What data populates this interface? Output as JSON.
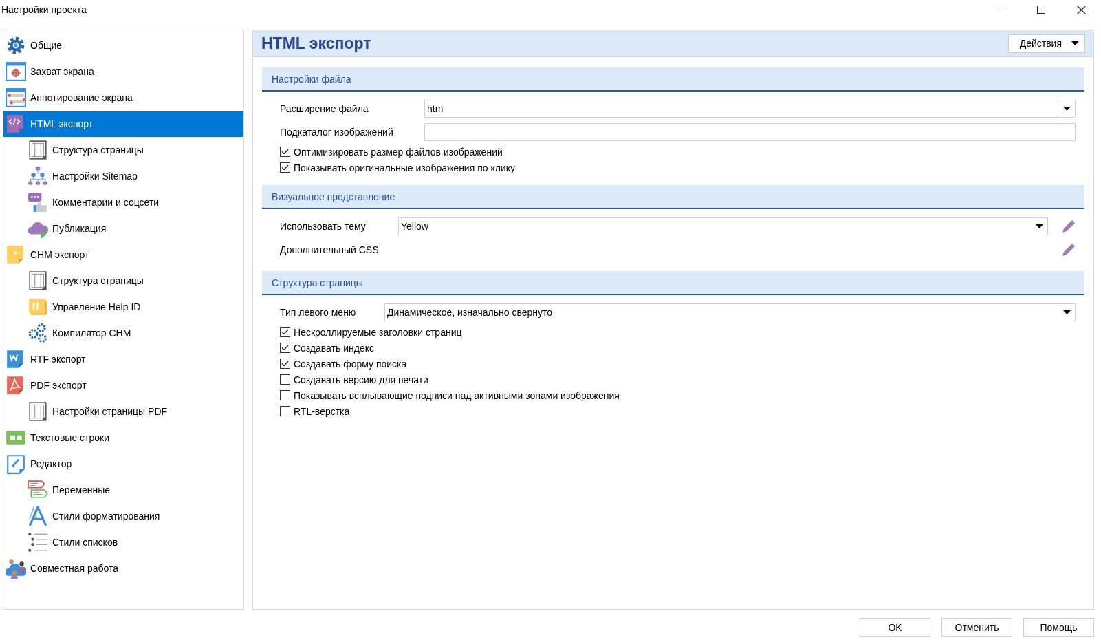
{
  "window": {
    "title": "Настройки проекта"
  },
  "sidebar": {
    "items": [
      {
        "label": "Общие",
        "selected": false
      },
      {
        "label": "Захват экрана",
        "selected": false
      },
      {
        "label": "Аннотирование экрана",
        "selected": false
      },
      {
        "label": "HTML экспорт",
        "selected": true,
        "children": [
          {
            "label": "Структура страницы",
            "selected": false
          },
          {
            "label": "Настройки Sitemap",
            "selected": false
          },
          {
            "label": "Комментарии и соцсети",
            "selected": false
          },
          {
            "label": "Публикация",
            "selected": false
          }
        ]
      },
      {
        "label": "CHM экспорт",
        "selected": false,
        "children": [
          {
            "label": "Структура страницы",
            "selected": false
          },
          {
            "label": "Управление Help ID",
            "selected": false
          },
          {
            "label": "Компилятор CHM",
            "selected": false
          }
        ]
      },
      {
        "label": "RTF экспорт",
        "selected": false
      },
      {
        "label": "PDF экспорт",
        "selected": false,
        "children": [
          {
            "label": "Настройки страницы PDF",
            "selected": false
          }
        ]
      },
      {
        "label": "Текстовые строки",
        "selected": false
      },
      {
        "label": "Редактор",
        "selected": false,
        "children": [
          {
            "label": "Переменные",
            "selected": false
          },
          {
            "label": "Стили форматирования",
            "selected": false
          },
          {
            "label": "Стили списков",
            "selected": false
          }
        ]
      },
      {
        "label": "Совместная работа",
        "selected": false
      }
    ]
  },
  "header": {
    "title": "HTML экспорт",
    "actions_button": "Действия"
  },
  "sections": [
    {
      "title": "Настройки файла",
      "rows": [
        {
          "kind": "dropdown",
          "label": "Расширение файла",
          "value": "htm"
        },
        {
          "kind": "text",
          "label": "Подкаталог изображений"
        },
        {
          "kind": "checkbox",
          "label": "Оптимизировать размер файлов изображений",
          "checked": true
        },
        {
          "kind": "checkbox",
          "label": "Показывать оригинальные изображения по клику",
          "checked": true
        }
      ]
    },
    {
      "title": "Визуальное представление",
      "rows": [
        {
          "kind": "dropdown-edit",
          "label": "Использовать тему",
          "value": "Yellow"
        },
        {
          "kind": "edit",
          "label": "Дополнительный CSS"
        }
      ]
    },
    {
      "title": "Структура страницы",
      "rows": [
        {
          "kind": "dropdown",
          "label": "Тип левого меню",
          "value": "Динамическое, изначально свернуто"
        },
        {
          "kind": "checkbox",
          "label": "Нескроллируемые заголовки страниц",
          "checked": true
        },
        {
          "kind": "checkbox",
          "label": "Создавать индекс",
          "checked": true
        },
        {
          "kind": "checkbox",
          "label": "Создавать форму поиска",
          "checked": true
        },
        {
          "kind": "checkbox",
          "label": "Создавать версию для печати",
          "checked": false
        },
        {
          "kind": "checkbox",
          "label": "Показывать всплывающие подписи над активными зонами изображения",
          "checked": false
        },
        {
          "kind": "checkbox",
          "label": "RTL-верстка",
          "checked": false
        }
      ]
    }
  ],
  "buttons": [
    "OK",
    "Отменить",
    "Помощь"
  ]
}
